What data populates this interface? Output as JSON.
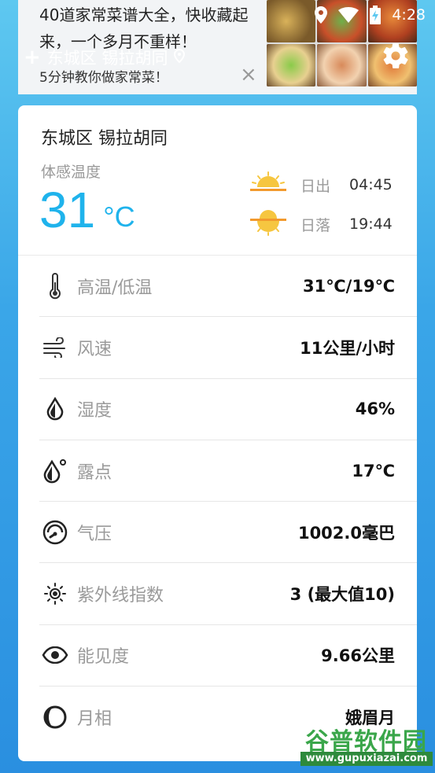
{
  "ad": {
    "headline": "40道家常菜谱大全，快收藏起来，一个多月不重样！",
    "subline": "5分钟教你做家常菜！",
    "close_symbol": "×"
  },
  "status_bar": {
    "time": "4:28"
  },
  "header": {
    "location": "东城区 锡拉胡同",
    "add_symbol": "+"
  },
  "weather": {
    "city": "东城区 锡拉胡同",
    "feels_like_label": "体感温度",
    "temperature": "31",
    "unit": "°C",
    "sunrise_label": "日出",
    "sunrise_time": "04:45",
    "sunset_label": "日落",
    "sunset_time": "19:44",
    "accent_color": "#1fb3ec"
  },
  "details": [
    {
      "icon": "thermometer-icon",
      "label": "高温/低温",
      "value": "31℃/19℃"
    },
    {
      "icon": "wind-icon",
      "label": "风速",
      "value": "11公里/小时"
    },
    {
      "icon": "humidity-drop-icon",
      "label": "湿度",
      "value": "46%"
    },
    {
      "icon": "dew-point-icon",
      "label": "露点",
      "value": "17℃"
    },
    {
      "icon": "pressure-gauge-icon",
      "label": "气压",
      "value": "1002.0毫巴"
    },
    {
      "icon": "uv-sun-icon",
      "label": "紫外线指数",
      "value": "3 (最大值10)"
    },
    {
      "icon": "eye-icon",
      "label": "能见度",
      "value": "9.66公里"
    },
    {
      "icon": "moon-phase-icon",
      "label": "月相",
      "value": "娥眉月"
    }
  ],
  "watermark": {
    "name": "谷普软件园",
    "url": "www.gupuxiazai.com"
  }
}
